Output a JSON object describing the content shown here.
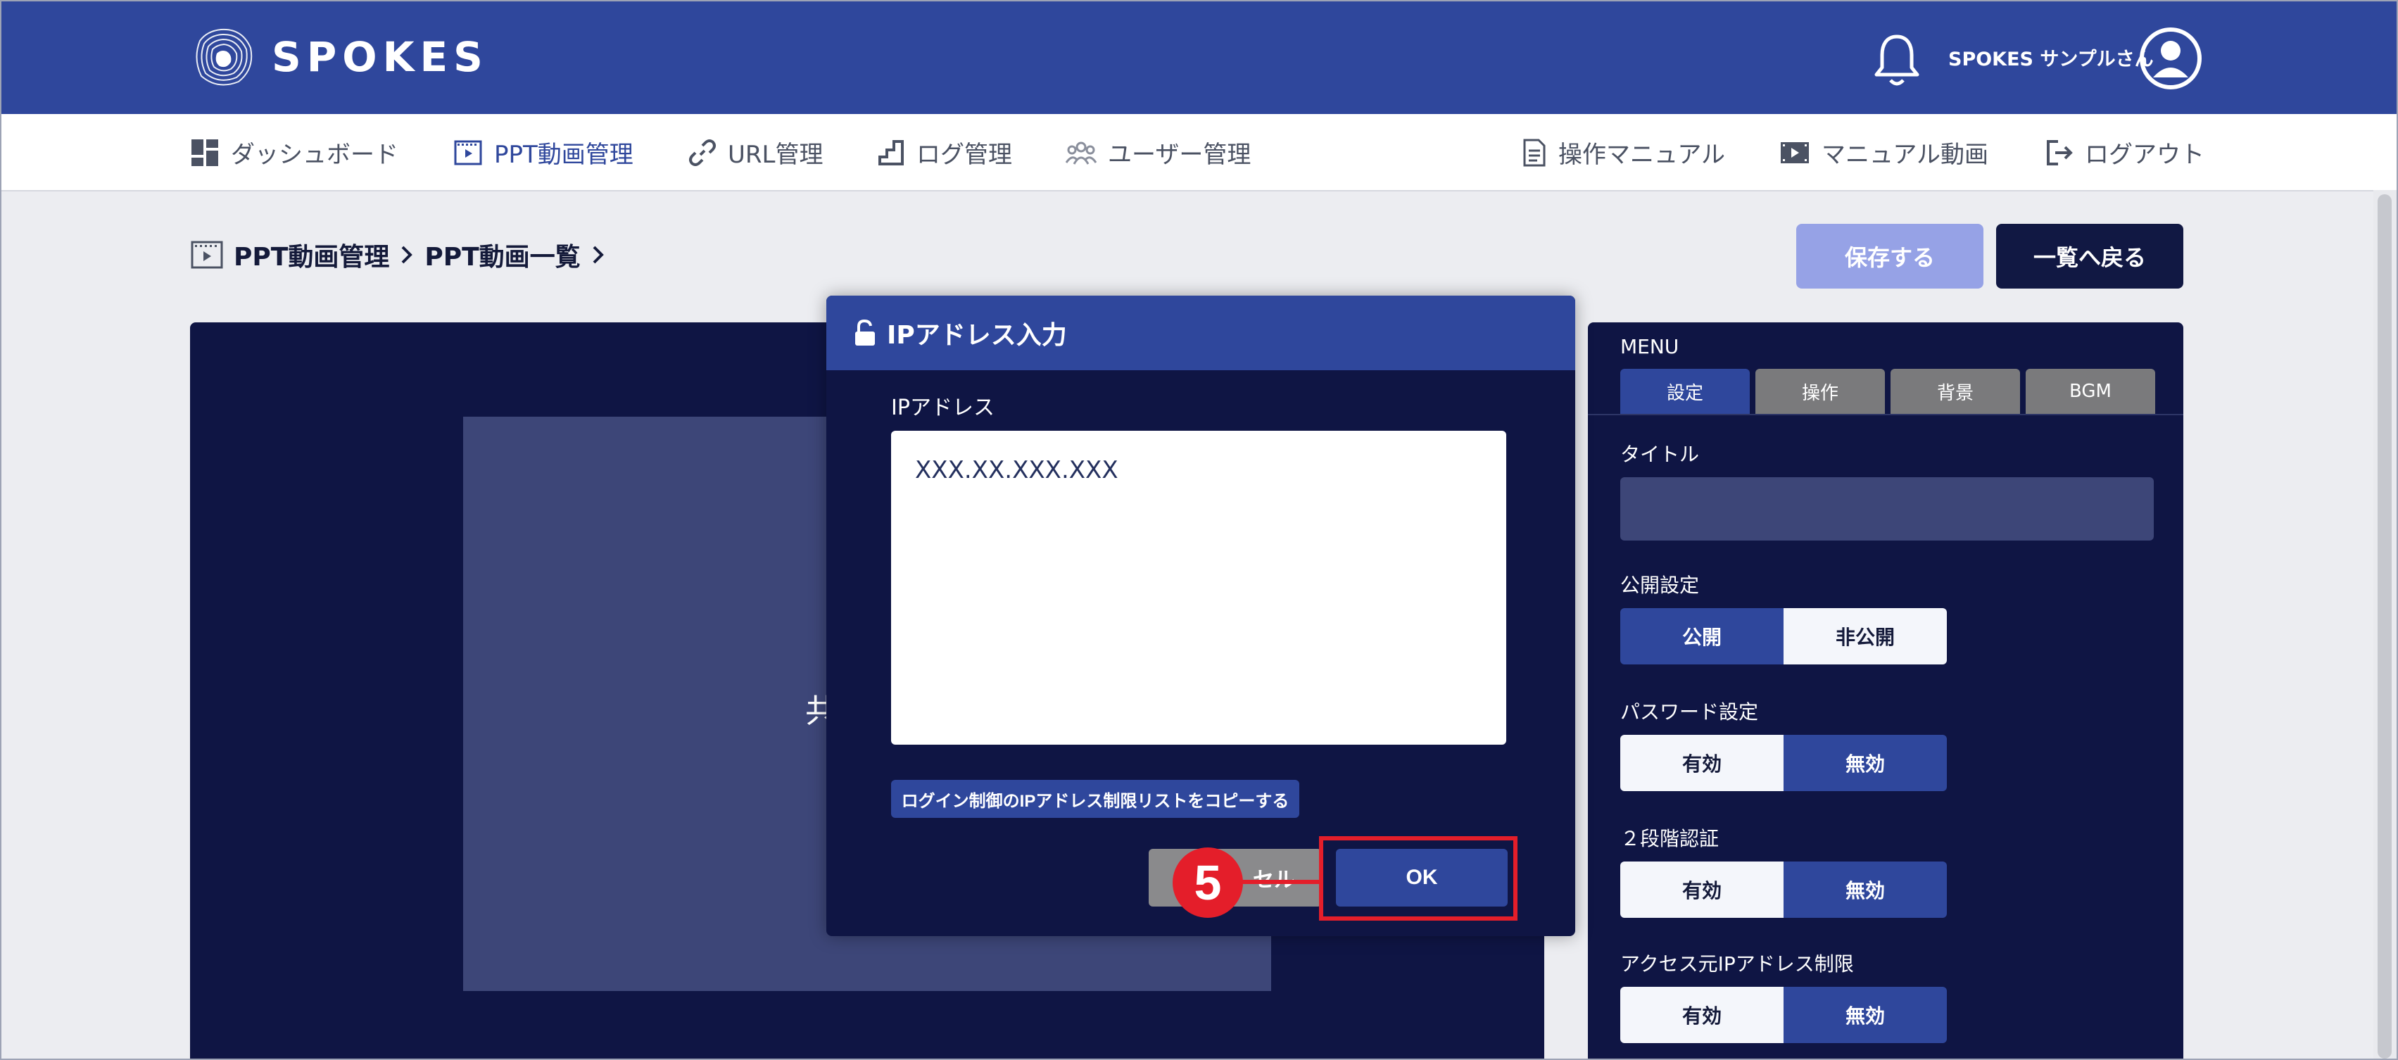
{
  "header": {
    "brand": "SPOKES",
    "username": "SPOKES サンプルさん"
  },
  "nav": {
    "dashboard": "ダッシュボード",
    "ppt": "PPT動画管理",
    "url": "URL管理",
    "log": "ログ管理",
    "user": "ユーザー管理",
    "manual": "操作マニュアル",
    "manual_video": "マニュアル動画",
    "logout": "ログアウト"
  },
  "breadcrumb": {
    "item1": "PPT動画管理",
    "item2": "PPT動画一覧"
  },
  "actions": {
    "save": "保存する",
    "back": "一覧へ戻る"
  },
  "preview": {
    "partial_text": "共"
  },
  "side": {
    "title": "MENU",
    "tabs": [
      "設定",
      "操作",
      "背景",
      "BGM"
    ],
    "title_label": "タイトル",
    "publish_label": "公開設定",
    "publish_on": "公開",
    "publish_off": "非公開",
    "password_label": "パスワード設定",
    "twofactor_label": "２段階認証",
    "ip_label": "アクセス元IPアドレス制限",
    "enabled": "有効",
    "disabled": "無効"
  },
  "modal": {
    "title": "IPアドレス入力",
    "field_label": "IPアドレス",
    "field_value": "XXX.XX.XXX.XXX",
    "copy_button": "ログイン制御のIPアドレス制限リストをコピーする",
    "cancel_button_partial": "セル",
    "ok_button": "OK"
  },
  "annotation": {
    "step": "5",
    "color": "#e41e2a"
  },
  "colors": {
    "primary": "#2f479c",
    "dark": "#0f1544",
    "save_disabled": "#96a2e6"
  }
}
